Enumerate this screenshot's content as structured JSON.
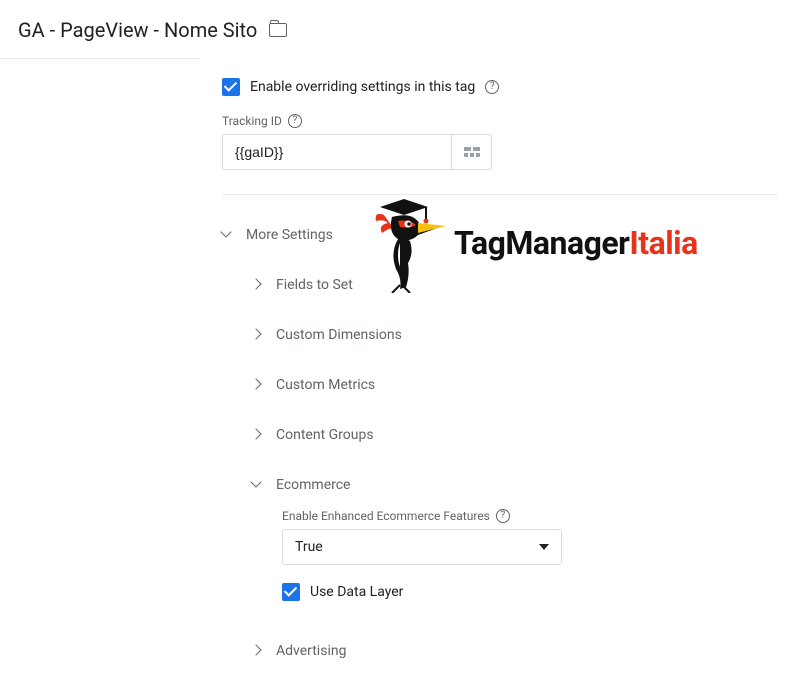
{
  "header": {
    "title": "GA - PageView - Nome Sito"
  },
  "override": {
    "label": "Enable overriding settings in this tag",
    "checked": true
  },
  "trackingId": {
    "label": "Tracking ID",
    "value": "{{gaID}}"
  },
  "moreSettings": {
    "label": "More Settings",
    "items": {
      "fieldsToSet": "Fields to Set",
      "customDimensions": "Custom Dimensions",
      "customMetrics": "Custom Metrics",
      "contentGroups": "Content Groups",
      "ecommerce": "Ecommerce",
      "advertising": "Advertising"
    }
  },
  "ecommerce": {
    "enhancedLabel": "Enable Enhanced Ecommerce Features",
    "enhancedValue": "True",
    "useDataLayer": {
      "label": "Use Data Layer",
      "checked": true
    }
  },
  "watermark": {
    "brandA": "TagManager",
    "brandB": "Italia"
  }
}
